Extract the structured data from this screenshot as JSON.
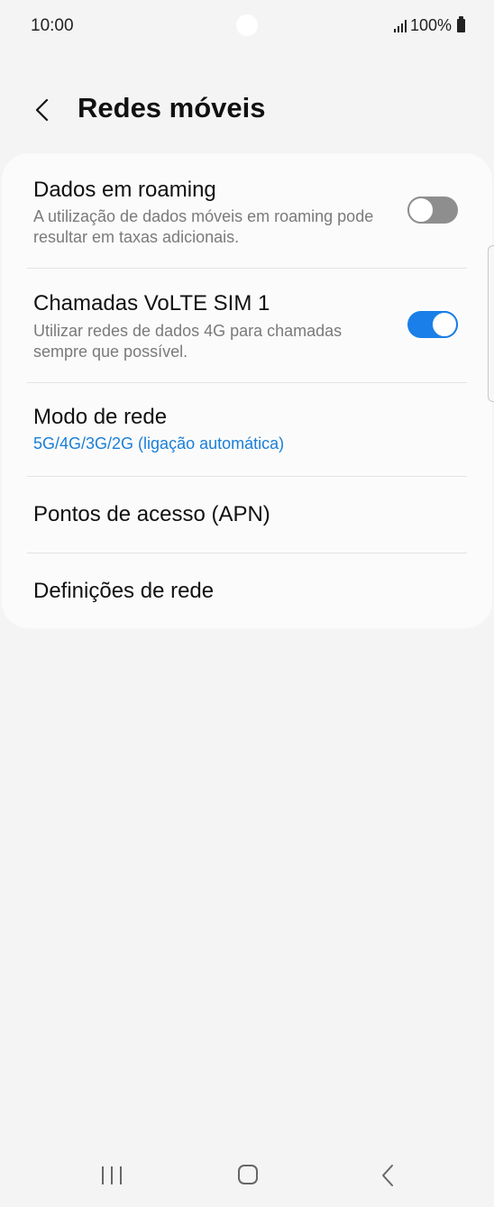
{
  "status_bar": {
    "time": "10:00",
    "battery": "100%"
  },
  "header": {
    "title": "Redes móveis"
  },
  "settings": {
    "roaming": {
      "title": "Dados em roaming",
      "subtitle": "A utilização de dados móveis em roaming pode resultar em taxas adicionais.",
      "enabled": false
    },
    "volte": {
      "title": "Chamadas VoLTE SIM 1",
      "subtitle": "Utilizar redes de dados 4G para chamadas sempre que possível.",
      "enabled": true
    },
    "network_mode": {
      "title": "Modo de rede",
      "value": "5G/4G/3G/2G (ligação automática)"
    },
    "apn": {
      "title": "Pontos de acesso (APN)"
    },
    "network_settings": {
      "title": "Definições de rede"
    }
  },
  "colors": {
    "accent": "#1a7fe8",
    "link": "#1a7fd8",
    "toggle_off": "#8e8e8e",
    "background": "#f4f4f4",
    "card": "#fbfbfb"
  },
  "icons": [
    "back-arrow-icon",
    "signal-icon",
    "battery-icon",
    "nav-recent-icon",
    "nav-home-icon",
    "nav-back-icon"
  ]
}
